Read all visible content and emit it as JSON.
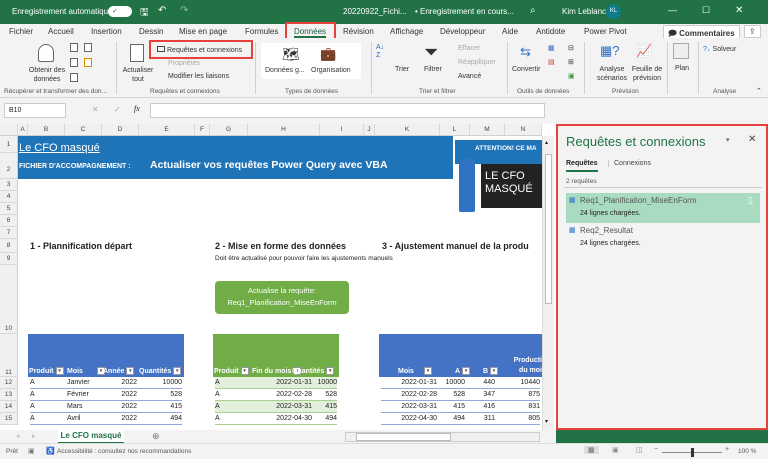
{
  "titlebar": {
    "autosave_label": "Enregistrement automatique",
    "autosave_state": "✓",
    "filename": "20220922_Fichi...",
    "save_status": "• Enregistrement en cours...",
    "user": "Kim Leblanc",
    "avatar_initials": "KL"
  },
  "tabs": [
    "Fichier",
    "Accueil",
    "Insertion",
    "Dessin",
    "Mise en page",
    "Formules",
    "Données",
    "Révision",
    "Affichage",
    "Développeur",
    "Aide",
    "Antidote",
    "Power Pivot"
  ],
  "active_tab": "Données",
  "comments_label": "Commentaires",
  "ribbon": {
    "get_data": "Obtenir des données",
    "group1": "Récupérer et transformer des don...",
    "refresh_all": "Actualiser tout",
    "queries_connections": "Requêtes et connexions",
    "properties": "Propriétés",
    "edit_links": "Modifier les liaisons",
    "group2": "Requêtes et connexions",
    "geo": "Données g...",
    "org": "Organisation",
    "group3": "Types de données",
    "sort": "Trier",
    "filter": "Filtrer",
    "clear": "Effacer",
    "reapply": "Réappliquer",
    "advanced": "Avancé",
    "group4": "Trier et filtrer",
    "convert": "Convertir",
    "group5": "Outils de données",
    "whatif": "Analyse scénarios",
    "forecast": "Feuille de prévision",
    "group6": "Prévision",
    "outline": "Plan",
    "solver": "Solveur",
    "group7": "Analyse"
  },
  "formula_bar": {
    "name_box": "B10",
    "fx": "fx",
    "value": ""
  },
  "columns": [
    "A",
    "B",
    "C",
    "D",
    "E",
    "F",
    "G",
    "H",
    "I",
    "J",
    "K",
    "L",
    "M",
    "N"
  ],
  "rows": [
    "1",
    "2",
    "3",
    "4",
    "5",
    "6",
    "7",
    "8",
    "9",
    "10",
    "11",
    "12",
    "13",
    "14",
    "15"
  ],
  "sheet": {
    "title": "Le CFO masqué",
    "subtitle_prefix": "FICHIER D'ACCOMPAGNEMENT : ",
    "subtitle": "Actualiser vos requêtes Power Query avec VBA",
    "attention": "ATTENTION! CE MA",
    "logo_text": "LE CFO MASQUÉ",
    "section1": "1 - Plannification départ",
    "section2": "2 - Mise en forme des données",
    "section2_note": "Doit être actualisé pour pouvoir faire les ajustements manuels",
    "section3": "3 - Ajustement manuel de la produ",
    "button_line1": "Actualise la requête:",
    "button_line2": "Req1_Planification_MiseEnForm",
    "table1": {
      "headers": [
        "Produit",
        "Mois",
        "Année",
        "Quantités"
      ],
      "rows": [
        [
          "A",
          "Janvier",
          "2022",
          "10000"
        ],
        [
          "A",
          "Février",
          "2022",
          "528"
        ],
        [
          "A",
          "Mars",
          "2022",
          "415"
        ],
        [
          "A",
          "Avril",
          "2022",
          "494"
        ]
      ]
    },
    "table2": {
      "headers": [
        "Produit",
        "Fin du mois",
        "Quantités"
      ],
      "rows": [
        [
          "A",
          "2022-01-31",
          "10000"
        ],
        [
          "A",
          "2022-02-28",
          "528"
        ],
        [
          "A",
          "2022-03-31",
          "415"
        ],
        [
          "A",
          "2022-04-30",
          "494"
        ]
      ]
    },
    "table3": {
      "headers": [
        "Mois",
        "A",
        "B",
        "Producti du moi"
      ],
      "rows": [
        [
          "2022-01-31",
          "10000",
          "440",
          "10440"
        ],
        [
          "2022-02-28",
          "528",
          "347",
          "875"
        ],
        [
          "2022-03-31",
          "415",
          "416",
          "831"
        ],
        [
          "2022-04-30",
          "494",
          "311",
          "805"
        ]
      ]
    }
  },
  "panel": {
    "title": "Requêtes et connexions",
    "tab_queries": "Requêtes",
    "tab_connections": "Connexions",
    "count": "2 requêtes",
    "items": [
      {
        "name": "Req1_Planification_MiseEnForm",
        "status": "24 lignes chargées."
      },
      {
        "name": "Req2_Resultat",
        "status": "24 lignes chargées."
      }
    ]
  },
  "sheet_tab": "Le CFO masqué",
  "status": {
    "ready": "Prêt",
    "accessibility": "Accessibilité : consultez nos recommandations",
    "zoom": "100 %"
  },
  "colors": {
    "excel_green": "#217346",
    "header_blue": "#4472c4",
    "title_blue": "#1f73b7",
    "table_green": "#70ad47",
    "highlight": "#a8dbc0",
    "red": "#e8403a"
  }
}
